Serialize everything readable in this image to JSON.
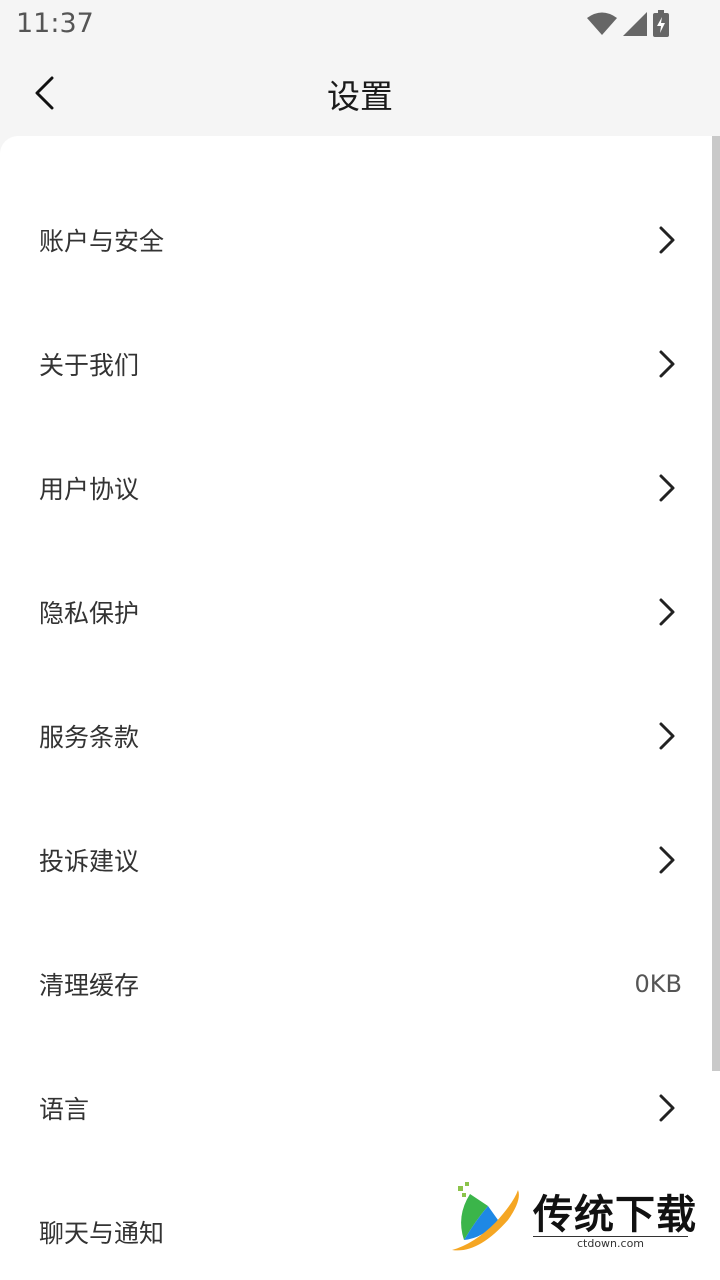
{
  "status_bar": {
    "time": "11:37"
  },
  "header": {
    "title": "设置"
  },
  "menu": {
    "items": [
      {
        "label": "账户与安全",
        "chevron": true
      },
      {
        "label": "关于我们",
        "chevron": true
      },
      {
        "label": "用户协议",
        "chevron": true
      },
      {
        "label": "隐私保护",
        "chevron": true
      },
      {
        "label": "服务条款",
        "chevron": true
      },
      {
        "label": "投诉建议",
        "chevron": true
      },
      {
        "label": "清理缓存",
        "value": "0KB"
      },
      {
        "label": "语言",
        "chevron": true
      },
      {
        "label": "聊天与通知"
      }
    ]
  },
  "watermark": {
    "title": "传统下载",
    "domain": "ctdown.com"
  },
  "icons": {
    "wifi": "wifi-icon",
    "signal": "signal-icon",
    "battery": "battery-charging-icon",
    "back": "back-arrow-icon",
    "chevron": "chevron-right-icon"
  },
  "colors": {
    "background": "#f5f5f5",
    "card": "#ffffff",
    "text": "#333333"
  }
}
